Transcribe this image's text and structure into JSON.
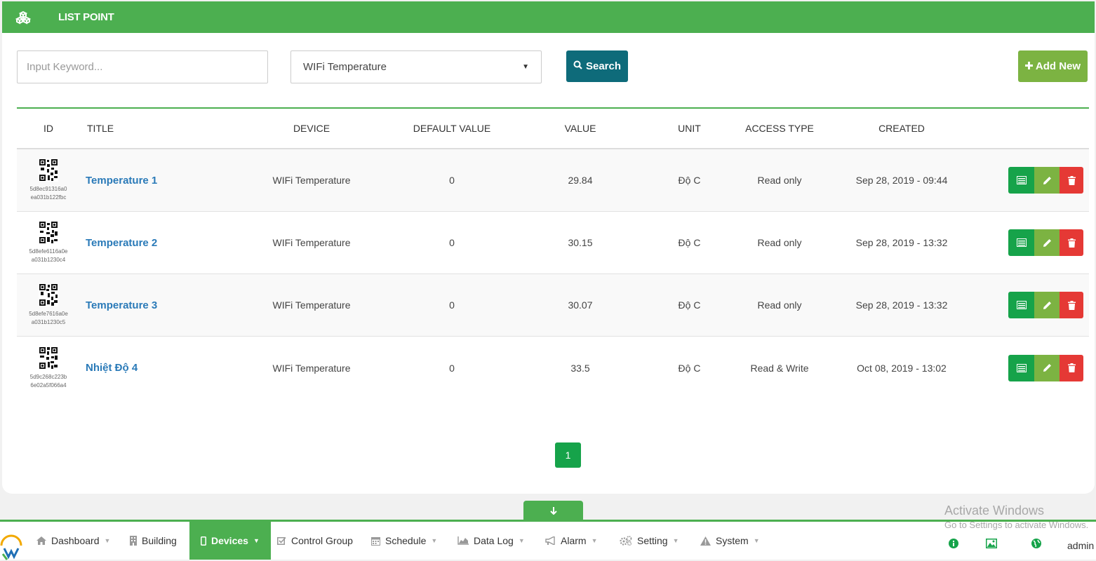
{
  "header": {
    "title": "LIST POINT",
    "icon": "cubes-icon"
  },
  "filters": {
    "keyword_placeholder": "Input Keyword...",
    "device_selected": "WIFi Temperature",
    "search_label": "Search",
    "add_label": "Add New"
  },
  "table": {
    "headers": {
      "id": "ID",
      "title": "TITLE",
      "device": "DEVICE",
      "default_value": "DEFAULT VALUE",
      "value": "VALUE",
      "unit": "UNIT",
      "access_type": "ACCESS TYPE",
      "created": "CREATED"
    },
    "rows": [
      {
        "id_line1": "5d8ec91316a0",
        "id_line2": "ea031b122fbc",
        "title": "Temperature 1",
        "device": "WIFi Temperature",
        "default_value": "0",
        "value": "29.84",
        "unit": "Độ C",
        "access_type": "Read only",
        "created": "Sep 28, 2019 - 09:44"
      },
      {
        "id_line1": "5d8efe6116a0e",
        "id_line2": "a031b1230c4",
        "title": "Temperature 2",
        "device": "WIFi Temperature",
        "default_value": "0",
        "value": "30.15",
        "unit": "Độ C",
        "access_type": "Read only",
        "created": "Sep 28, 2019 - 13:32"
      },
      {
        "id_line1": "5d8efe7616a0e",
        "id_line2": "a031b1230c5",
        "title": "Temperature 3",
        "device": "WIFi Temperature",
        "default_value": "0",
        "value": "30.07",
        "unit": "Độ C",
        "access_type": "Read only",
        "created": "Sep 28, 2019 - 13:32"
      },
      {
        "id_line1": "5d9c268c223b",
        "id_line2": "6e02a5f066a4",
        "title": "Nhiệt Độ 4",
        "device": "WIFi Temperature",
        "default_value": "0",
        "value": "33.5",
        "unit": "Độ C",
        "access_type": "Read & Write",
        "created": "Oct 08, 2019 - 13:02"
      }
    ]
  },
  "pagination": {
    "current": "1"
  },
  "watermark": {
    "line1": "Activate Windows",
    "line2": "Go to Settings to activate Windows."
  },
  "nav": {
    "items": [
      {
        "label": "Dashboard",
        "icon": "home-icon"
      },
      {
        "label": "Building",
        "icon": "building-icon"
      },
      {
        "label": "Devices",
        "icon": "mobile-icon"
      },
      {
        "label": "Control Group",
        "icon": "checkbox-icon"
      },
      {
        "label": "Schedule",
        "icon": "calendar-icon"
      },
      {
        "label": "Data Log",
        "icon": "area-chart-icon"
      },
      {
        "label": "Alarm",
        "icon": "bullhorn-icon"
      },
      {
        "label": "Setting",
        "icon": "cogs-icon"
      },
      {
        "label": "System",
        "icon": "warning-icon"
      }
    ],
    "right_icons": [
      "info-icon",
      "image-icon",
      "globe-icon"
    ],
    "user": "admin"
  },
  "colors": {
    "primary_green": "#4caf50",
    "search_teal": "#0e6b7a",
    "add_green": "#7cb342",
    "delete_red": "#e53935",
    "link_blue": "#2a7ab8"
  }
}
